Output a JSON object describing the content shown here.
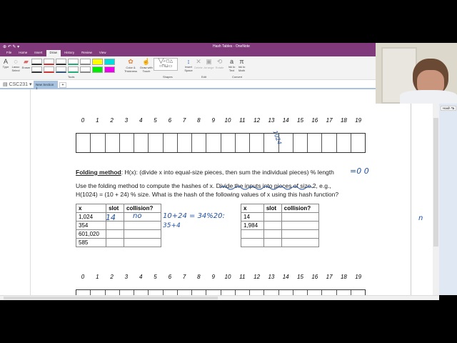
{
  "window": {
    "title": "Hash Tables - OneNote"
  },
  "ribbon_tabs": [
    "File",
    "Home",
    "Insert",
    "Draw",
    "History",
    "Review",
    "View"
  ],
  "active_tab": "Draw",
  "ribbon": {
    "tools": [
      {
        "label": "Type"
      },
      {
        "label": "Lasso Select"
      },
      {
        "label": "Eraser"
      }
    ],
    "color_thickness": "Color & Thickness",
    "draw_touch": "Draw with Touch",
    "insert_space": "Insert Space",
    "delete": "Delete",
    "arrange": "Arrange",
    "rotate": "Rotate",
    "ink_to_text": "Ink to Text",
    "ink_to_math": "Ink to Math",
    "groups": [
      "Tools",
      "Shapes",
      "Edit",
      "Convert"
    ]
  },
  "notebook": "CSC231",
  "section_tab": "New Section 1",
  "add_tab": "+",
  "side_pane_tab": "Hash Ta",
  "indices": [
    "0",
    "1",
    "2",
    "3",
    "4",
    "5",
    "6",
    "7",
    "8",
    "9",
    "10",
    "11",
    "12",
    "13",
    "14",
    "15",
    "16",
    "17",
    "18",
    "19"
  ],
  "heading": {
    "bold": "Folding method",
    "rest": ": H(x): (divide x into equal-size pieces, then sum the individual pieces) % length"
  },
  "instructions": [
    "Use the folding method to compute the hashes of x. Divide the inputs into pieces of size 2, e.g.,",
    "H(1024) = (10 + 24) % size. What is the hash of the following values of x using this hash function?"
  ],
  "table1": {
    "headers": [
      "x",
      "slot",
      "collision?"
    ],
    "rows": [
      [
        "1,024",
        "",
        ""
      ],
      [
        "354",
        "",
        ""
      ],
      [
        "601,020",
        "",
        ""
      ],
      [
        "585",
        "",
        ""
      ]
    ]
  },
  "table2": {
    "headers": [
      "x",
      "slot",
      "collision?"
    ],
    "rows": [
      [
        "14",
        "",
        ""
      ],
      [
        "1,984",
        "",
        ""
      ],
      [
        "",
        "",
        ""
      ],
      [
        "",
        "",
        ""
      ]
    ]
  },
  "ink": {
    "cell14": "1024",
    "slot1": "14",
    "coll1": "no",
    "calc1": "10+24 = 34%20:",
    "calc2": "35+4",
    "heading_note": "=0 0",
    "side": "n"
  }
}
